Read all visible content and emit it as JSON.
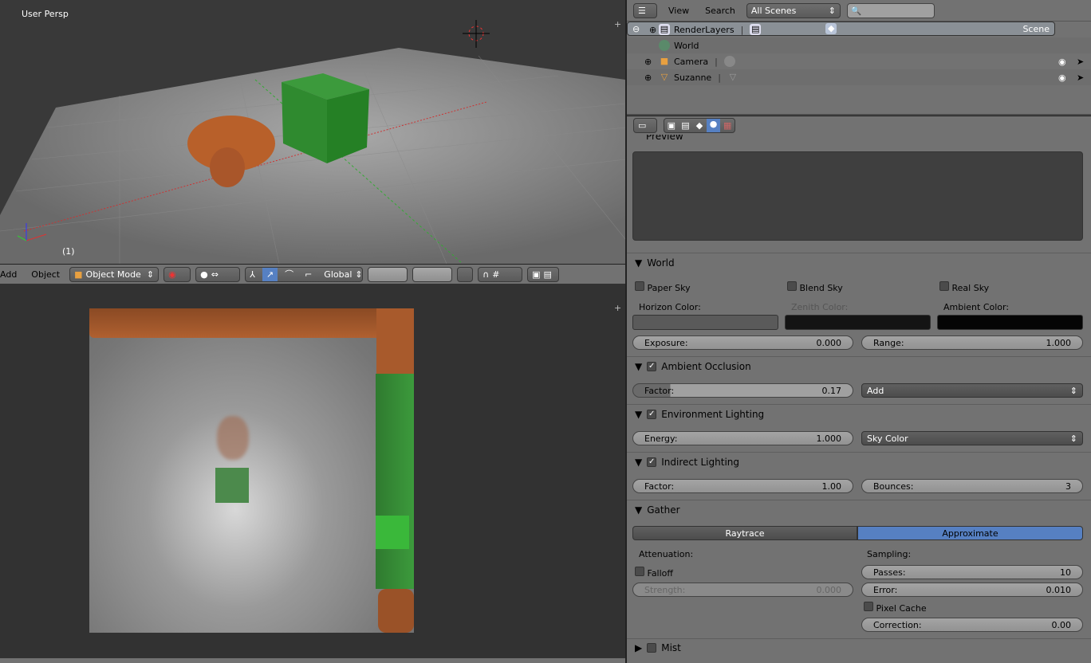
{
  "viewport3d": {
    "view_label": "User Persp",
    "frame_label": "(1)",
    "header": {
      "menus": [
        "Add",
        "Object"
      ],
      "mode": "Object Mode",
      "orientation": "Global"
    }
  },
  "outliner": {
    "view_menu": "View",
    "search_menu": "Search",
    "scenes_select": "All Scenes",
    "search_placeholder": "",
    "items": [
      {
        "label": "Scene",
        "icon": "scene-icon"
      },
      {
        "label": "RenderLayers",
        "icon": "render-layers-icon"
      },
      {
        "label": "World",
        "icon": "world-icon"
      },
      {
        "label": "Camera",
        "icon": "camera-icon"
      },
      {
        "label": "Suzanne",
        "icon": "mesh-icon"
      }
    ]
  },
  "properties": {
    "preview_title": "Preview",
    "world": {
      "title": "World",
      "paper_sky": "Paper Sky",
      "blend_sky": "Blend Sky",
      "real_sky": "Real Sky",
      "horizon_label": "Horizon Color:",
      "zenith_label": "Zenith Color:",
      "ambient_label": "Ambient Color:",
      "horizon_color": "#5a5a5a",
      "zenith_color": "#141414",
      "ambient_color": "#050505",
      "exposure_label": "Exposure:",
      "exposure": "0.000",
      "range_label": "Range:",
      "range": "1.000"
    },
    "ao": {
      "title": "Ambient Occlusion",
      "factor_label": "Factor:",
      "factor": "0.17",
      "blend": "Add"
    },
    "env": {
      "title": "Environment Lighting",
      "energy_label": "Energy:",
      "energy": "1.000",
      "source": "Sky Color"
    },
    "indirect": {
      "title": "Indirect Lighting",
      "factor_label": "Factor:",
      "factor": "1.00",
      "bounces_label": "Bounces:",
      "bounces": "3"
    },
    "gather": {
      "title": "Gather",
      "raytrace": "Raytrace",
      "approximate": "Approximate",
      "attenuation_label": "Attenuation:",
      "falloff": "Falloff",
      "strength_label": "Strength:",
      "strength": "0.000",
      "sampling_label": "Sampling:",
      "passes_label": "Passes:",
      "passes": "10",
      "error_label": "Error:",
      "error": "0.010",
      "pixel_cache": "Pixel Cache",
      "correction_label": "Correction:",
      "correction": "0.00"
    },
    "mist": {
      "title": "Mist"
    }
  },
  "colors": {
    "accent": "#5680c2"
  }
}
